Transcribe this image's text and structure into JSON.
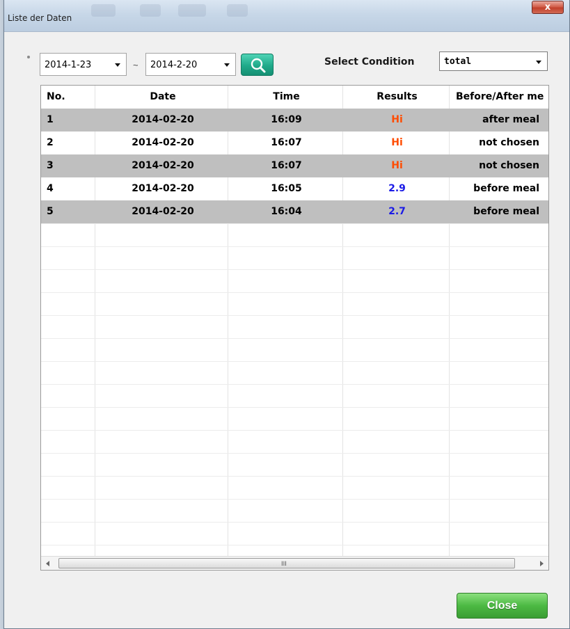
{
  "window": {
    "title": "Liste der Daten",
    "close_glyph": "x"
  },
  "filter": {
    "date_from": "2014-1-23",
    "separator": "~",
    "date_to": "2014-2-20",
    "search_icon": "search-icon",
    "condition_label": "Select Condition",
    "condition_value": "total"
  },
  "table": {
    "headers": [
      "No.",
      "Date",
      "Time",
      "Results",
      "Before/After me"
    ],
    "rows": [
      {
        "no": "1",
        "date": "2014-02-20",
        "time": "16:09",
        "result": "Hi",
        "meal": "after meal"
      },
      {
        "no": "2",
        "date": "2014-02-20",
        "time": "16:07",
        "result": "Hi",
        "meal": "not chosen"
      },
      {
        "no": "3",
        "date": "2014-02-20",
        "time": "16:07",
        "result": "Hi",
        "meal": "not chosen"
      },
      {
        "no": "4",
        "date": "2014-02-20",
        "time": "16:05",
        "result": "2.9",
        "meal": "before meal"
      },
      {
        "no": "5",
        "date": "2014-02-20",
        "time": "16:04",
        "result": "2.7",
        "meal": "before meal"
      }
    ],
    "scroll_grip": "III"
  },
  "colors": {
    "hi_result": "#ff4c00",
    "numeric_result": "#1a1ae6",
    "row_shade": "#bfbfbf",
    "close_button": "#4cb943",
    "search_button": "#1faa8a"
  },
  "footer": {
    "close_label": "Close"
  }
}
